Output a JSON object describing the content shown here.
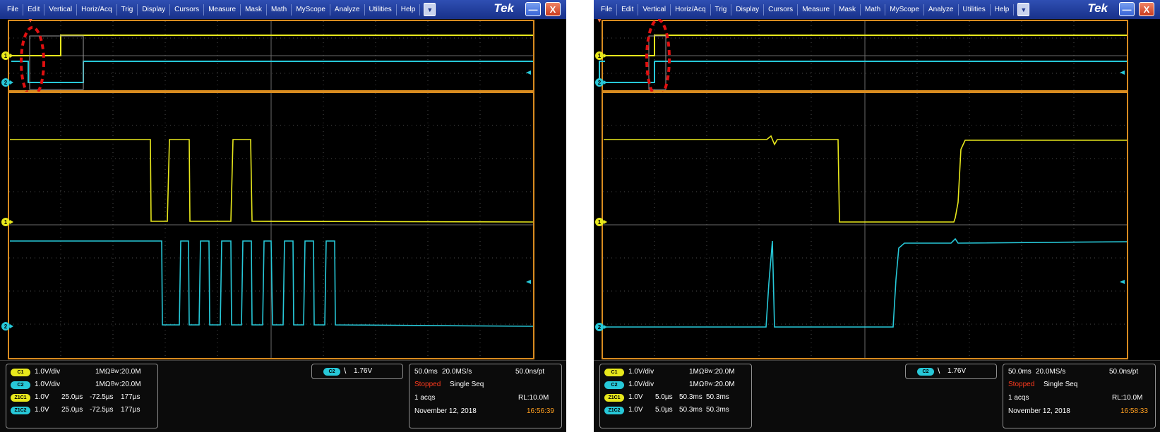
{
  "menu": [
    "File",
    "Edit",
    "Vertical",
    "Horiz/Acq",
    "Trig",
    "Display",
    "Cursors",
    "Measure",
    "Mask",
    "Math",
    "MyScope",
    "Analyze",
    "Utilities",
    "Help"
  ],
  "brand": "Tek",
  "window_buttons": {
    "minimize": "—",
    "close": "X"
  },
  "marker_labels": {
    "ch1": "1",
    "ch2": "2"
  },
  "colors": {
    "ch1": "#e8e81c",
    "ch2": "#27c8d8",
    "grid": "#5a5a5a",
    "border": "#d98c20",
    "annotation": "#e01010"
  },
  "scopes": [
    {
      "id": "left",
      "channels": [
        {
          "badge": "C1",
          "scale": "1.0V/div",
          "impedance": "1MΩ",
          "bw_label": "Bw",
          "bandwidth": ":20.0M"
        },
        {
          "badge": "C2",
          "scale": "1.0V/div",
          "impedance": "1MΩ",
          "bw_label": "Bw",
          "bandwidth": ":20.0M"
        }
      ],
      "zooms": [
        {
          "badge": "Z1C1",
          "scale": "1.0V",
          "time": "25.0µs",
          "pos": "-72.5µs",
          "span": "177µs"
        },
        {
          "badge": "Z1C2",
          "scale": "1.0V",
          "time": "25.0µs",
          "pos": "-72.5µs",
          "span": "177µs"
        }
      ],
      "trigger": {
        "badge": "C2",
        "slope": "falling-edge-icon",
        "level": "1.76V"
      },
      "horizontal": {
        "timebase": "50.0ms",
        "sample_rate": "20.0MS/s",
        "resolution": "50.0ns/pt",
        "state": "Stopped",
        "mode": "Single Seq",
        "acqs": "1 acqs",
        "record_length": "RL:10.0M",
        "date": "November 12, 2018",
        "time": "16:56:39"
      }
    },
    {
      "id": "right",
      "channels": [
        {
          "badge": "C1",
          "scale": "1.0V/div",
          "impedance": "1MΩ",
          "bw_label": "Bw",
          "bandwidth": ":20.0M"
        },
        {
          "badge": "C2",
          "scale": "1.0V/div",
          "impedance": "1MΩ",
          "bw_label": "Bw",
          "bandwidth": ":20.0M"
        }
      ],
      "zooms": [
        {
          "badge": "Z1C1",
          "scale": "1.0V",
          "time": "5.0µs",
          "pos": "50.3ms",
          "span": "50.3ms"
        },
        {
          "badge": "Z1C2",
          "scale": "1.0V",
          "time": "5.0µs",
          "pos": "50.3ms",
          "span": "50.3ms"
        }
      ],
      "trigger": {
        "badge": "C2",
        "slope": "falling-edge-icon",
        "level": "1.76V"
      },
      "horizontal": {
        "timebase": "50.0ms",
        "sample_rate": "20.0MS/s",
        "resolution": "50.0ns/pt",
        "state": "Stopped",
        "mode": "Single Seq",
        "acqs": "1 acqs",
        "record_length": "RL:10.0M",
        "date": "November 12, 2018",
        "time": "16:58:33"
      }
    }
  ]
}
